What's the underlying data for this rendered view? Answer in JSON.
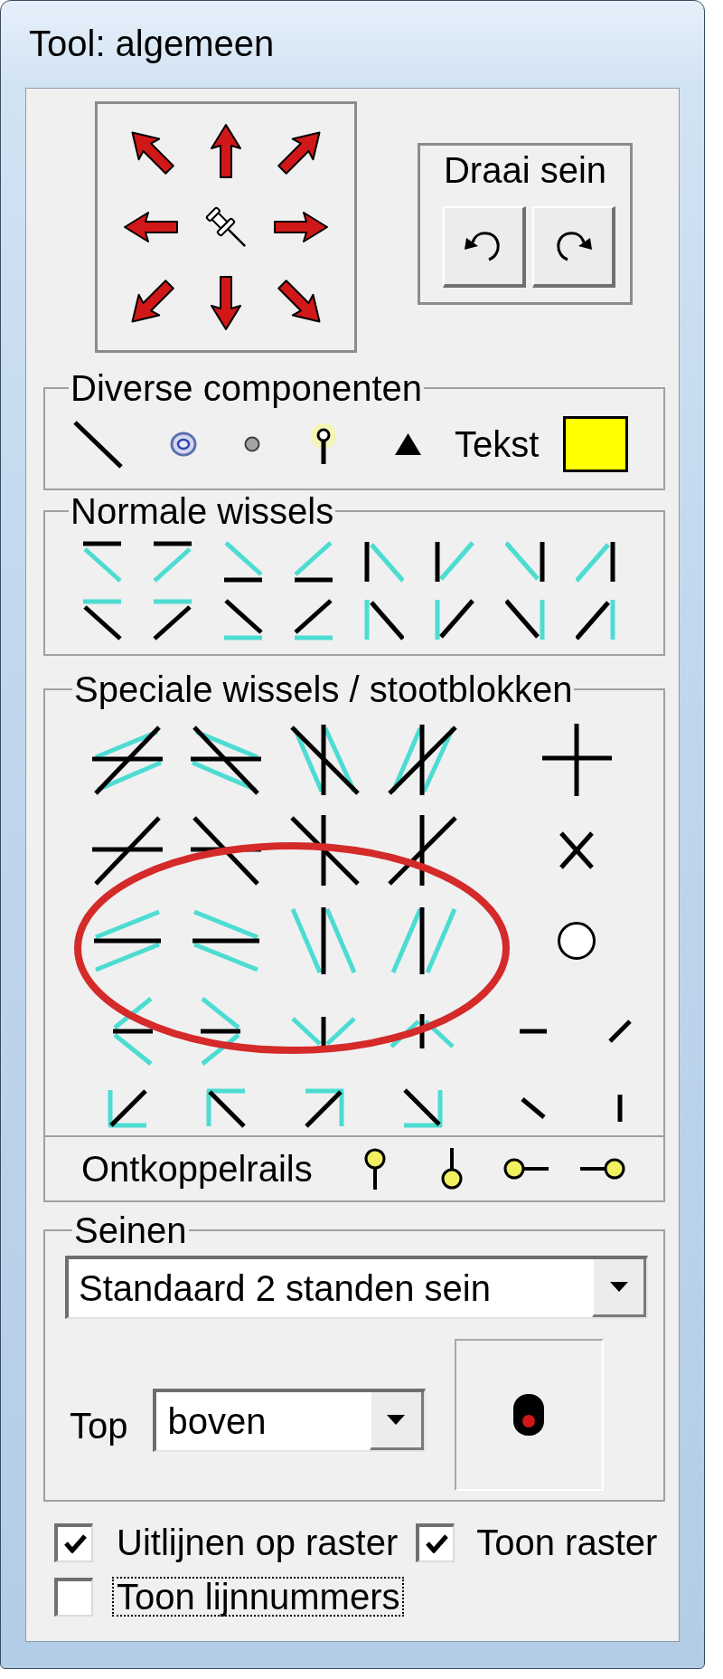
{
  "window": {
    "title": "Tool: algemeen"
  },
  "rotate_signal": {
    "label": "Draai sein"
  },
  "misc_components": {
    "title": "Diverse componenten",
    "text_tool": "Tekst"
  },
  "normal_switches": {
    "title": "Normale wissels"
  },
  "special_switches": {
    "title": "Speciale wissels / stootblokken",
    "decouplers_label": "Ontkoppelrails"
  },
  "signals": {
    "title": "Seinen",
    "type_dropdown": {
      "value": "Standaard 2 standen sein"
    },
    "top_label": "Top",
    "top_dropdown": {
      "value": "boven"
    }
  },
  "options": [
    {
      "label": "Uitlijnen op raster",
      "checked": true,
      "focused": false
    },
    {
      "label": "Toon raster",
      "checked": true,
      "focused": false
    },
    {
      "label": "Toon lijnnummers",
      "checked": false,
      "focused": true
    }
  ]
}
